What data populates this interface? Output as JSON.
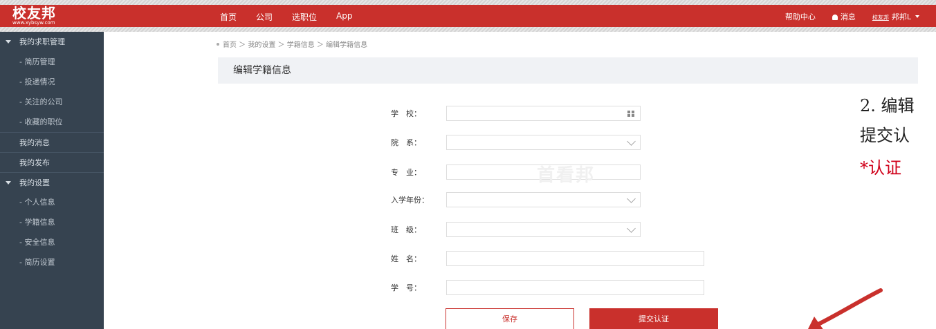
{
  "header": {
    "logo_main": "校友邦",
    "logo_sub": "www.xybsyw.com",
    "nav": [
      "首页",
      "公司",
      "选职位",
      "App"
    ],
    "help": "帮助中心",
    "messages": "消息",
    "mini_logo": "校友邦",
    "user": "邦邦L"
  },
  "sidebar": {
    "items": [
      {
        "label": "我的求职管理",
        "group": true
      },
      {
        "label": "- 简历管理"
      },
      {
        "label": "- 投递情况"
      },
      {
        "label": "- 关注的公司"
      },
      {
        "label": "- 收藏的职位"
      },
      {
        "label": "我的消息"
      },
      {
        "label": "我的发布"
      },
      {
        "label": "我的设置",
        "group": true
      },
      {
        "label": "- 个人信息"
      },
      {
        "label": "- 学籍信息"
      },
      {
        "label": "- 安全信息"
      },
      {
        "label": "- 简历设置"
      }
    ]
  },
  "breadcrumb": [
    "首页",
    "我的设置",
    "学籍信息",
    "编辑学籍信息"
  ],
  "panel_title": "编辑学籍信息",
  "form": {
    "school": "学　校：",
    "department": "院　系：",
    "major": "专　业：",
    "enroll_year": "入学年份：",
    "class": "班　级：",
    "name": "姓　名：",
    "student_id": "学　号："
  },
  "watermark": "首看邦",
  "buttons": {
    "save": "保存",
    "submit": "提交认证"
  },
  "annotation": {
    "line1": "2. 编辑",
    "line2": "提交认",
    "line3": "*认证"
  },
  "colors": {
    "brand": "#c9302c",
    "sidebar": "#364350",
    "annotation_red": "#d0021b"
  }
}
